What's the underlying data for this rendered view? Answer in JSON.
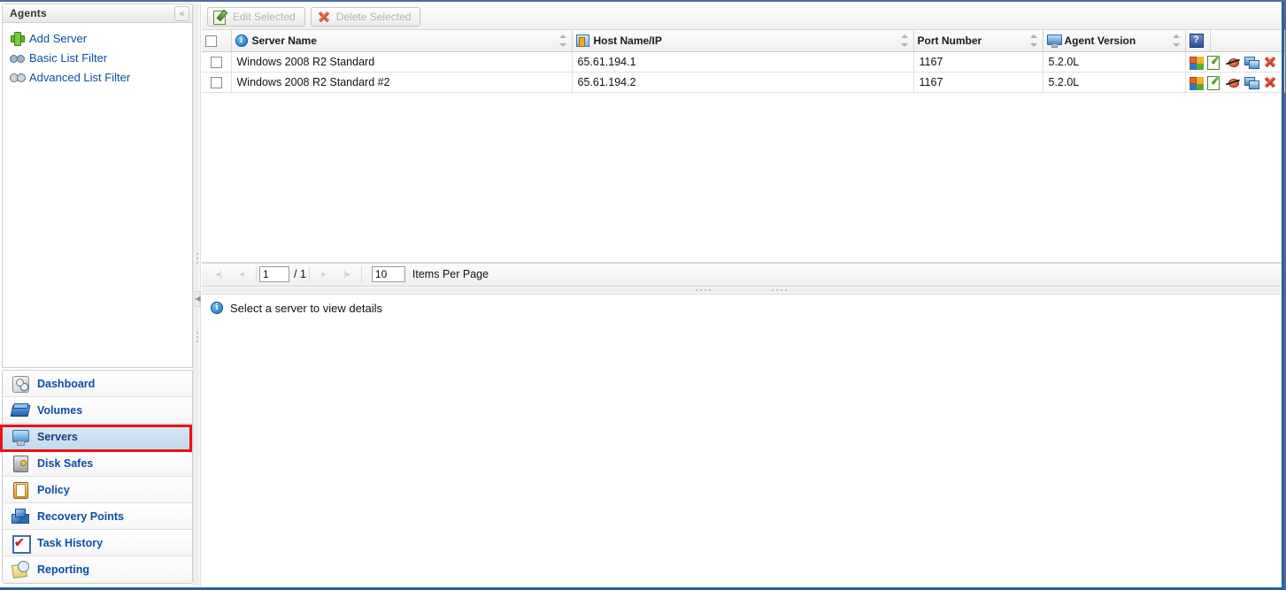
{
  "sidebar": {
    "header_title": "Agents",
    "collapse_icon": "chevron-double-left-icon",
    "links": [
      {
        "label": "Add Server",
        "icon": "plus-green-icon"
      },
      {
        "label": "Basic List Filter",
        "icon": "binoculars-icon"
      },
      {
        "label": "Advanced List Filter",
        "icon": "binoculars-advanced-icon"
      }
    ],
    "nav": [
      {
        "label": "Dashboard",
        "icon": "dashboard-icon",
        "selected": false
      },
      {
        "label": "Volumes",
        "icon": "book-icon",
        "selected": false
      },
      {
        "label": "Servers",
        "icon": "monitor-icon",
        "selected": true
      },
      {
        "label": "Disk Safes",
        "icon": "safe-icon",
        "selected": false
      },
      {
        "label": "Policy",
        "icon": "clipboard-icon",
        "selected": false
      },
      {
        "label": "Recovery Points",
        "icon": "cubes-icon",
        "selected": false
      },
      {
        "label": "Task History",
        "icon": "checkbox-check-icon",
        "selected": false
      },
      {
        "label": "Reporting",
        "icon": "report-clock-icon",
        "selected": false
      }
    ]
  },
  "toolbar": {
    "edit_label": "Edit Selected",
    "edit_icon": "edit-pencil-icon",
    "delete_label": "Delete Selected",
    "delete_icon": "red-x-icon"
  },
  "grid": {
    "columns": [
      {
        "label": "Server Name",
        "icon": "info-icon",
        "sortable": true
      },
      {
        "label": "Host Name/IP",
        "icon": "host-icon",
        "sortable": true
      },
      {
        "label": "Port Number",
        "icon": "",
        "sortable": true
      },
      {
        "label": "Agent Version",
        "icon": "monitor-small-icon",
        "sortable": true
      }
    ],
    "help_icon": "help-question-icon",
    "rows": [
      {
        "checked": false,
        "server_name": "Windows 2008 R2 Standard",
        "host_name_ip": "65.61.194.1",
        "port_number": "1167",
        "agent_version": "5.2.0L"
      },
      {
        "checked": false,
        "server_name": "Windows 2008 R2 Standard #2",
        "host_name_ip": "65.61.194.2",
        "port_number": "1167",
        "agent_version": "5.2.0L"
      }
    ],
    "row_actions": [
      "windows-tiles-icon",
      "edit-pencil-icon",
      "disable-icon",
      "copy-servers-icon",
      "delete-red-x-icon"
    ]
  },
  "pager": {
    "first_icon": "first-page-icon",
    "prev_icon": "prev-page-icon",
    "next_icon": "next-page-icon",
    "last_icon": "last-page-icon",
    "page_value": "1",
    "total_pages": "/ 1",
    "items_per_page_value": "10",
    "items_per_page_label": "Items Per Page"
  },
  "details": {
    "icon": "info-icon",
    "message": "Select a server to view details"
  },
  "colors": {
    "link": "#0b4fa0",
    "selection_bg": "#c3d8f0",
    "highlight_box": "#ee1111",
    "window_border": "#2f5f96"
  }
}
